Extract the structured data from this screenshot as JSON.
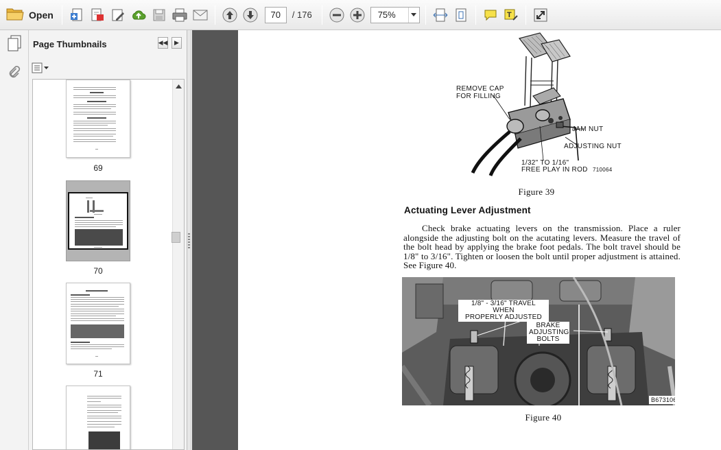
{
  "toolbar": {
    "open_label": "Open",
    "current_page": "70",
    "page_total": "/ 176",
    "zoom": "75%"
  },
  "thumbnails": {
    "title": "Page Thumbnails",
    "pages": [
      {
        "number": "69"
      },
      {
        "number": "70",
        "selected": true
      },
      {
        "number": "71"
      }
    ]
  },
  "document": {
    "figure39": {
      "labels": {
        "remove_cap_line1": "REMOVE CAP",
        "remove_cap_line2": "FOR FILLING",
        "jam_nut": "JAM NUT",
        "adjusting_nut": "ADJUSTING NUT",
        "free_play_line1": "1/32\" TO 1/16\"",
        "free_play_line2": "FREE PLAY IN ROD",
        "code": "710064"
      },
      "caption": "Figure 39"
    },
    "heading": "Actuating Lever Adjustment",
    "paragraph": "Check brake actuating levers on the transmission. Place a ruler alongside the adjusting bolt on the acutating levers. Measure the travel of the bolt head by applying the brake foot pedals. The bolt travel should be 1/8\" to 3/16\". Tighten or loosen the bolt until proper adjustment is attained. See Figure 40.",
    "figure40": {
      "labels": {
        "travel_line1": "1/8\" - 3/16\" TRAVEL WHEN",
        "travel_line2": "PROPERLY ADJUSTED",
        "brake_line1": "BRAKE",
        "brake_line2": "ADJUSTING",
        "brake_line3": "BOLTS",
        "code": "B673106"
      },
      "caption": "Figure 40"
    }
  }
}
